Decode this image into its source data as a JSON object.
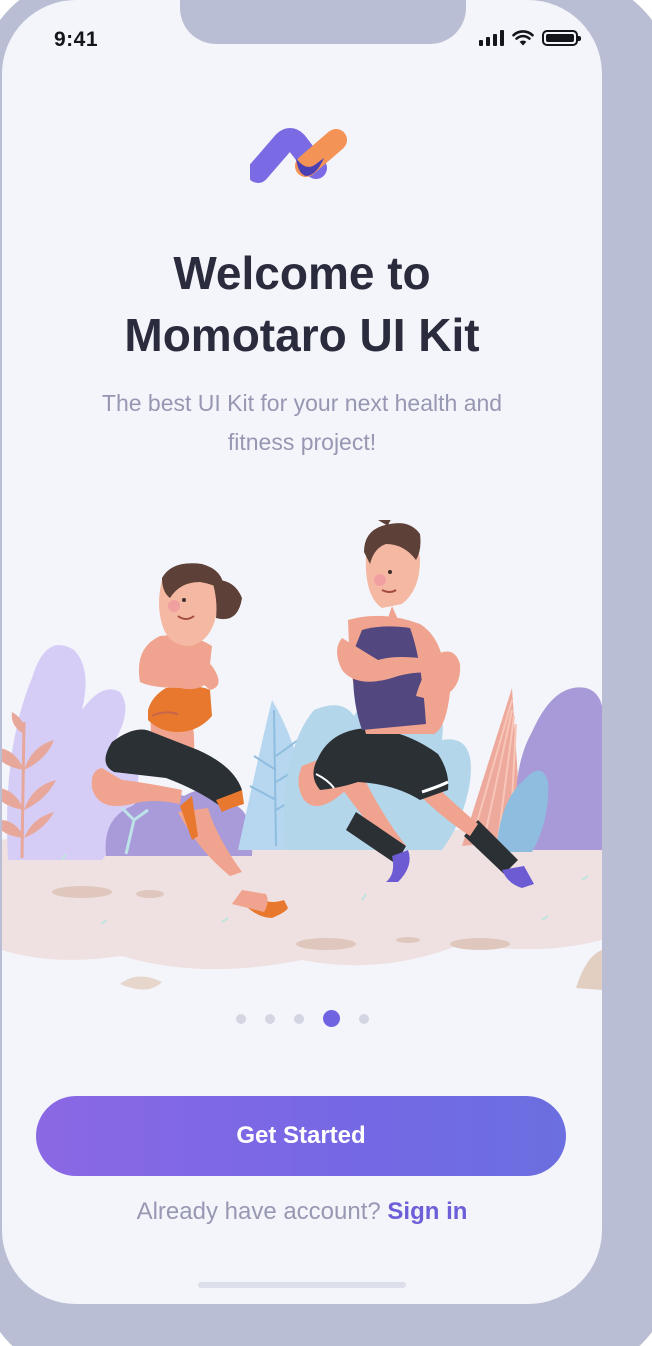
{
  "status_bar": {
    "time": "9:41",
    "icons": [
      "signal-icon",
      "wifi-icon",
      "battery-icon"
    ]
  },
  "logo": {
    "icon": "momotaro-logo-icon",
    "colors": {
      "purple": "#7a6be4",
      "dark": "#4a3fb5",
      "orange": "#f49356"
    }
  },
  "onboarding": {
    "title_line1": "Welcome to",
    "title_line2": "Momotaro UI Kit",
    "subtitle": "The best UI Kit for your next health and fitness project!",
    "illustration": "two-joggers-illustration",
    "pager": {
      "total": 5,
      "active": 4
    }
  },
  "cta": {
    "label": "Get Started"
  },
  "signin": {
    "prompt": "Already have account?",
    "link": "Sign in"
  },
  "colors": {
    "accent": "#7568e4",
    "link": "#6d5fd8",
    "title": "#2a2c3e",
    "muted": "#9697b2",
    "background": "#f4f5fa"
  }
}
